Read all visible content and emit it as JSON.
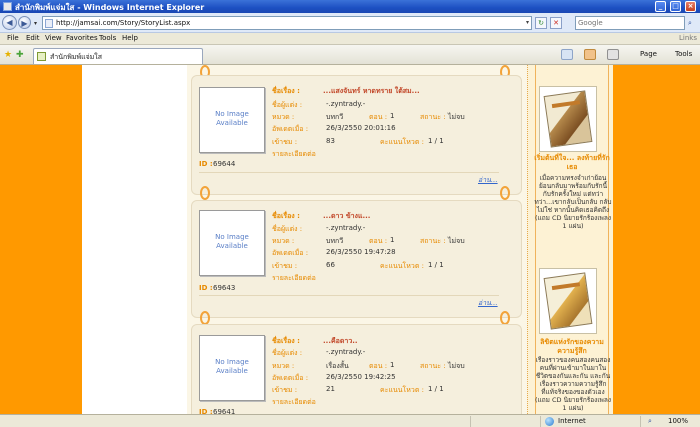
{
  "window": {
    "title": "สำนักพิมพ์แจ่มใส - Windows Internet Explorer"
  },
  "address": {
    "url": "http://jamsai.com/Story/StoryList.aspx"
  },
  "search": {
    "placeholder": "Google"
  },
  "menu": {
    "items": [
      "File",
      "Edit",
      "View",
      "Favorites",
      "Tools",
      "Help"
    ],
    "links": "Links"
  },
  "tab": {
    "label": "สำนักพิมพ์แจ่มใส"
  },
  "commands": {
    "page": "Page",
    "tools": "Tools"
  },
  "labels": {
    "title": "ชื่อเรื่อง :",
    "author": "ชื่อผู้แต่ง :",
    "category": "หมวด :",
    "chapter": "ตอน :",
    "status": "สถานะ :",
    "updated": "อัพเดตเมื่อ :",
    "views": "เข้าชม :",
    "rating": "คะแนนโหวต :",
    "details": "รายละเอียดต่อ",
    "id": "ID :",
    "more": "อ่าน...",
    "no_image": [
      "No Image",
      "Available"
    ]
  },
  "stories": [
    {
      "title": "...แสงจันทร์ หาดทราย ใต้สม...",
      "author": "-.zyntrady.-",
      "category": "บทกวี",
      "chapter": "1",
      "status": "ไม่จบ",
      "updated": "26/3/2550 20:01:16",
      "views": "83",
      "rating": "1 / 1",
      "id": "69644"
    },
    {
      "title": "...ดาว ข้างแ...",
      "author": "-.zyntrady.-",
      "category": "บทกวี",
      "chapter": "1",
      "status": "ไม่จบ",
      "updated": "26/3/2550 19:47:28",
      "views": "66",
      "rating": "1 / 1",
      "id": "69643"
    },
    {
      "title": "...คือดาว..",
      "author": "-.zyntrady.-",
      "category": "เรื่องสั้น",
      "chapter": "1",
      "status": "ไม่จบ",
      "updated": "26/3/2550 19:42:25",
      "views": "21",
      "rating": "1 / 1",
      "id": "69641"
    }
  ],
  "sidebar_books": [
    {
      "title": "เริ่มต้นที่ใจ... ลงท้ายที่รักเธอ",
      "desc": "เมื่อความทรงจำเก่าย้อนย้อนกลับมาพร้อมกับรักนี้ กับรักครั้งใหม่ แต่ทว่า ทว่า...เขากลับเป็นกลับ กลับ ไม่ใช่ หากนั้นคิดเธอคิดถึง (แถม CD นิยายรักร้องเพลง 1 แผ่น)"
    },
    {
      "title": "ลิขิตแห่งรักของความความรู้สึก",
      "desc": "เรื่องราวของคนสองคนสองคนที่ผ่านเข้ามาในมาในชีวิตของกันและกัน และกัน เรื่องราวความความรู้สึกที่แท้จริงของของตัวเอง (แถม CD นิยายรักร้องเพลง 1 แผ่น)"
    }
  ],
  "status": {
    "zone": "Internet",
    "zoom": "100%"
  }
}
